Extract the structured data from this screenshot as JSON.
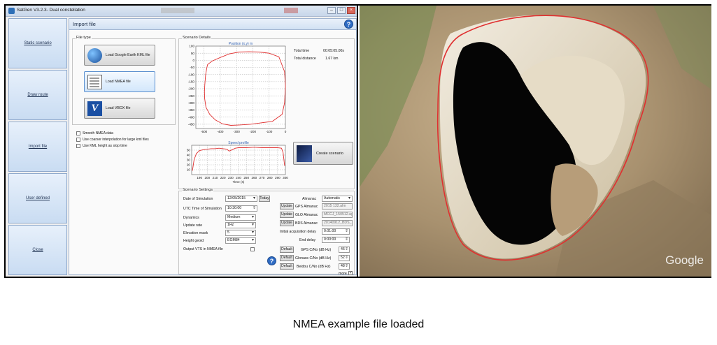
{
  "window": {
    "title": "SatGen V3.2.3- Dual constellation"
  },
  "sidebar": {
    "items": [
      {
        "label": "Static scenario"
      },
      {
        "label": "Draw route"
      },
      {
        "label": "Import file"
      },
      {
        "label": "User defined"
      },
      {
        "label": "Close"
      }
    ]
  },
  "panel": {
    "title": "Import file"
  },
  "file_type": {
    "title": "File type",
    "buttons": [
      {
        "label": "Load Google Earth KML file",
        "icon": "google-earth-icon"
      },
      {
        "label": "Load NMEA file",
        "icon": "nmea-file-icon"
      },
      {
        "label": "Load VBOX file",
        "icon": "vbox-icon"
      }
    ],
    "options": [
      {
        "label": "Smooth NMEA data",
        "checked": false
      },
      {
        "label": "Use coarser interpolation for large kml files",
        "checked": false
      },
      {
        "label": "Use KML height as stop time",
        "checked": false
      }
    ]
  },
  "scenario_details": {
    "title": "Scenario Details",
    "total_time_label": "Total time",
    "total_time_value": "00:05:05.00s",
    "total_distance_label": "Total distance",
    "total_distance_value": "1.67 km",
    "create_label": "Create scenario"
  },
  "chart_data": [
    {
      "type": "line",
      "title": "Position (x,y) m",
      "xlabel": "",
      "ylabel": "",
      "xlim": [
        -550,
        0
      ],
      "ylim": [
        -480,
        100
      ],
      "xticks": [
        -500,
        -400,
        -300,
        -200,
        -100,
        0
      ],
      "yticks": [
        100,
        50,
        0,
        -50,
        -100,
        -150,
        -200,
        -250,
        -300,
        -350,
        -400,
        -450
      ],
      "grid": true,
      "color": "#e03030",
      "series": [
        {
          "x": [
            -482,
            -490,
            -495,
            -497,
            -496,
            -488,
            -465,
            -430,
            -385,
            -335,
            -280,
            -215,
            -150,
            -80,
            -20,
            -5,
            0,
            -5,
            -40,
            -100,
            -160,
            -225,
            -285,
            -345,
            -400,
            -450,
            -478,
            -482
          ],
          "y": [
            -50,
            -100,
            -170,
            -220,
            -270,
            -330,
            -380,
            -420,
            -448,
            -458,
            -455,
            -450,
            -440,
            -430,
            -380,
            -300,
            -180,
            -80,
            25,
            50,
            58,
            60,
            58,
            45,
            20,
            -5,
            -30,
            -50
          ]
        }
      ]
    },
    {
      "type": "line",
      "title": "Speed profile",
      "xlabel": "Time (s)",
      "ylabel": "",
      "xlim": [
        180,
        300
      ],
      "ylim": [
        0,
        60
      ],
      "xticks": [
        190,
        200,
        210,
        220,
        230,
        240,
        250,
        260,
        270,
        280,
        290,
        300
      ],
      "yticks": [
        50,
        40,
        30,
        20,
        10
      ],
      "grid": true,
      "color": "#e03030",
      "series": [
        {
          "x": [
            181,
            183,
            186,
            190,
            195,
            200,
            205,
            210,
            215,
            220,
            225,
            228,
            232,
            236,
            240,
            250,
            260,
            270,
            280,
            290,
            295,
            297,
            299
          ],
          "y": [
            8,
            30,
            43,
            49,
            51,
            52,
            53,
            53,
            54,
            53,
            52,
            48,
            51,
            54,
            55,
            55,
            56,
            55,
            55,
            55,
            54,
            45,
            18
          ]
        }
      ]
    }
  ],
  "scenario_settings": {
    "title": "Scenario Settings",
    "date_label": "Date of Simulation",
    "date_value": "12/05/2015",
    "today_label": "Today",
    "utc_label": "UTC Time of Simulation",
    "utc_value": "10:30:00",
    "dynamics_label": "Dynamics",
    "dynamics_value": "Medium",
    "update_rate_label": "Update rate",
    "update_rate_value": "1Hz",
    "elevation_label": "Elevation mask",
    "elevation_value": "5",
    "geoid_label": "Height geoid",
    "geoid_value": "EGM84",
    "vts_label": "Output VTS in NMEA file",
    "almanac_label": "Almanac",
    "almanac_value": "Automatic",
    "update_label": "Update",
    "gps_almanac_label": "GPS Almanac",
    "gps_almanac_value": "2015 132.alm",
    "glo_almanac_label": "GLO Almanac",
    "glo_almanac_value": "MCCJ_150512.ag",
    "bds_almanac_label": "BDS Almanac",
    "bds_almanac_value": "20140912_BDS_",
    "initial_delay_label": "Initial acquisition delay",
    "initial_delay_value": "0:01:00",
    "end_delay_label": "End delay",
    "end_delay_value": "0:00:00",
    "default_label": "Default",
    "gps_cno_label": "GPS C/No (dB Hz)",
    "gps_cno_value": "46",
    "glonass_cno_label": "Glonass C/No (dB Hz)",
    "glonass_cno_value": "52",
    "beidou_cno_label": "Beidou C/No (dB Hz)",
    "beidou_cno_value": "48",
    "more_label": "more"
  },
  "map": {
    "watermark": "Google"
  },
  "caption": "NMEA example file loaded",
  "colors": {
    "route": "#e03030",
    "accent": "#2f6cc4"
  }
}
